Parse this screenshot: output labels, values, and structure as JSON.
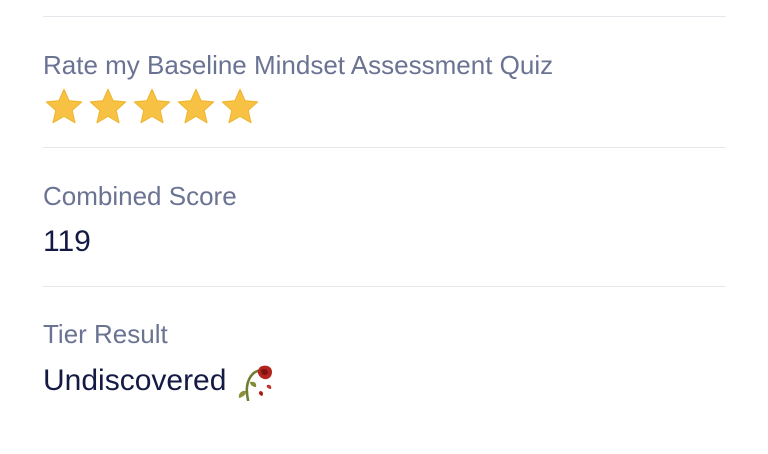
{
  "rating": {
    "label": "Rate my Baseline Mindset Assessment Quiz",
    "stars_filled": 5,
    "stars_total": 5,
    "star_color": "#F7C244"
  },
  "combined_score": {
    "label": "Combined Score",
    "value": "119"
  },
  "tier": {
    "label": "Tier Result",
    "value": "Undiscovered",
    "icon": "wilted-rose-icon"
  },
  "colors": {
    "label": "#6B7393",
    "value": "#141A44",
    "divider": "#E6E7EC"
  }
}
